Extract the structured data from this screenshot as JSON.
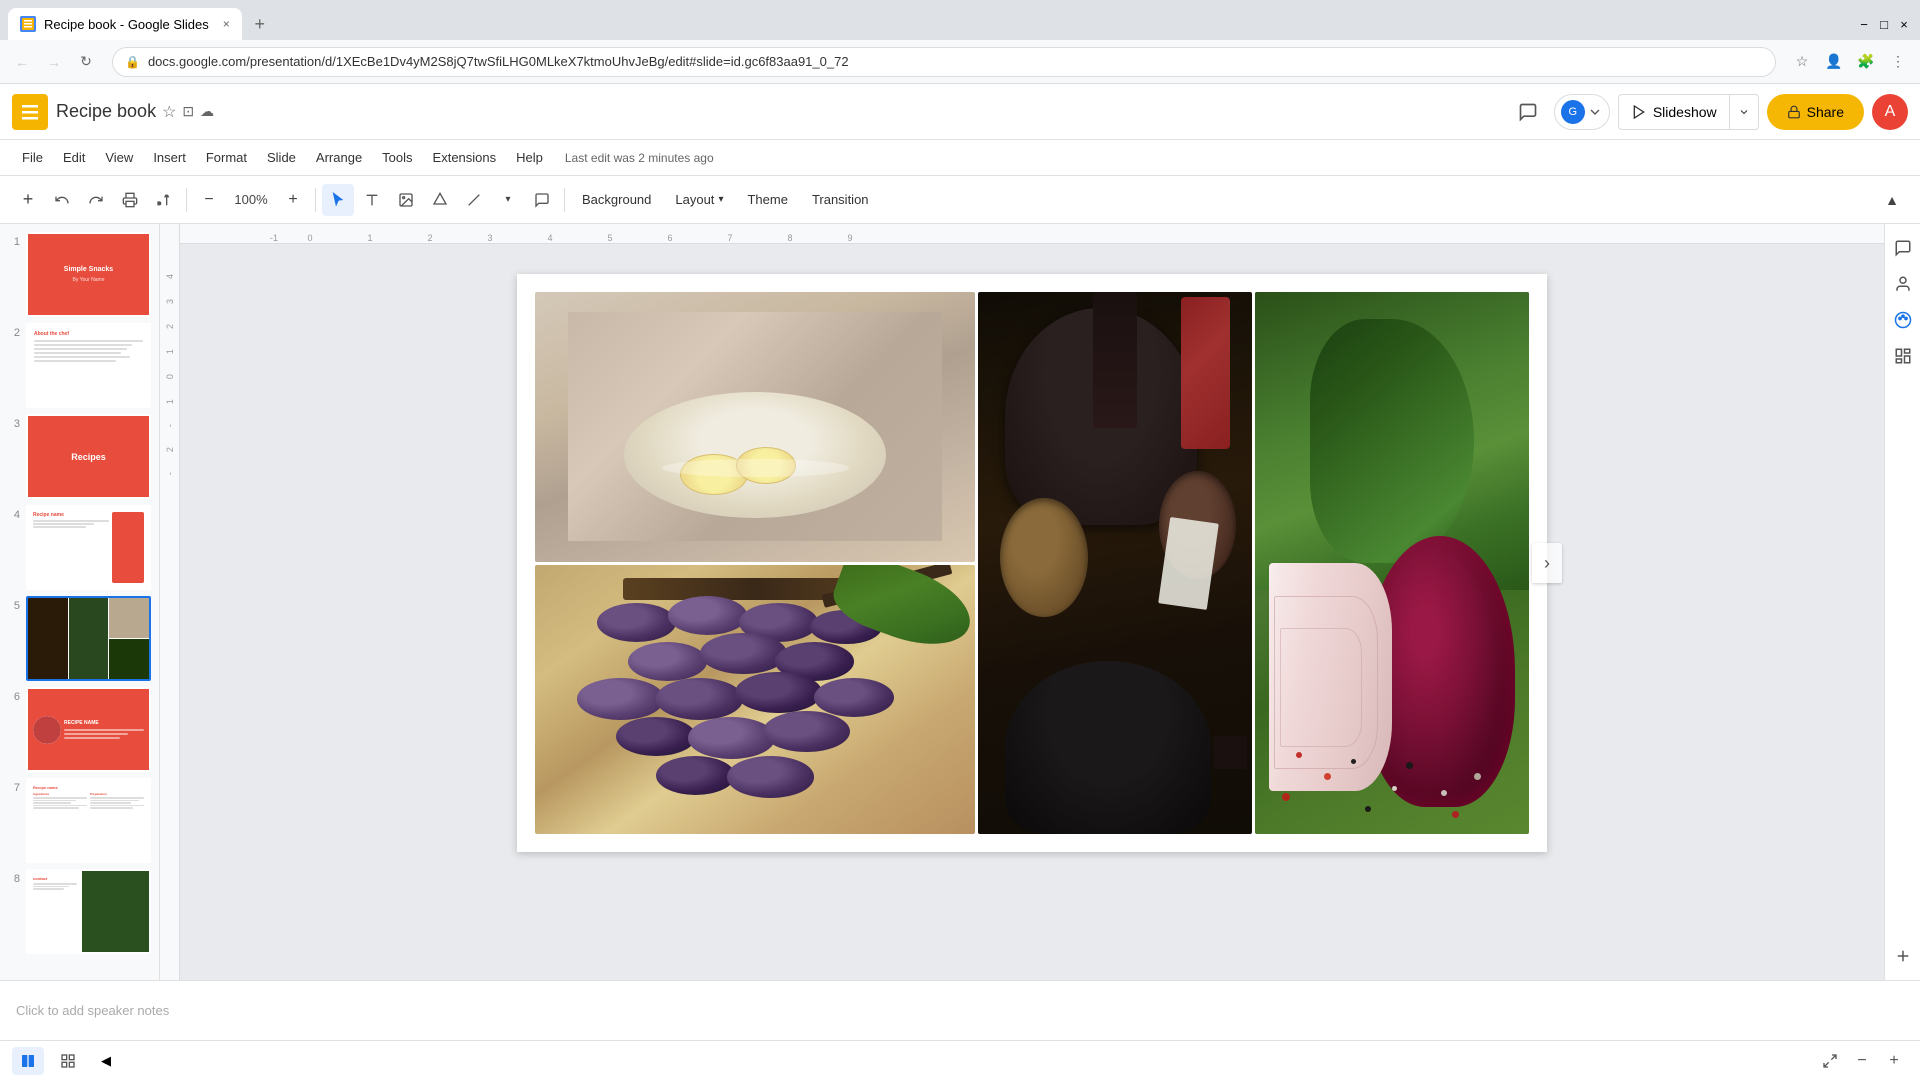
{
  "browser": {
    "tab_title": "Recipe book - Google Slides",
    "favicon_color": "#f4b400",
    "url": "docs.google.com/presentation/d/1XEcBe1Dv4yM2S8jQ7twSfiLHG0MLkeX7ktmoUhvJeBg/edit#slide=id.gc6f83aa91_0_72",
    "new_tab_label": "+",
    "tab_close": "×"
  },
  "header": {
    "app_logo_letter": "S",
    "doc_title": "Recipe book",
    "star_icon": "☆",
    "folder_icon": "📁",
    "cloud_icon": "☁",
    "comment_icon": "💬",
    "slideshow_label": "Slideshow",
    "slideshow_dropdown": "▾",
    "share_label": "Share",
    "share_icon": "🔒",
    "user_initial": "A"
  },
  "menu": {
    "items": [
      "File",
      "Edit",
      "View",
      "Insert",
      "Format",
      "Slide",
      "Arrange",
      "Tools",
      "Extensions",
      "Help"
    ],
    "last_edit": "Last edit was 2 minutes ago"
  },
  "toolbar": {
    "add_icon": "+",
    "undo_icon": "↩",
    "redo_icon": "↪",
    "print_icon": "🖨",
    "paint_icon": "🖌",
    "zoom_out": "−",
    "zoom_value": "100%",
    "zoom_in": "+",
    "select_icon": "↖",
    "text_icon": "T",
    "image_icon": "🖼",
    "shape_icon": "⬡",
    "line_icon": "/",
    "background_label": "Background",
    "layout_label": "Layout",
    "layout_arrow": "▾",
    "theme_label": "Theme",
    "transition_label": "Transition",
    "collapse_icon": "▲"
  },
  "slides": [
    {
      "num": "1",
      "type": "cover"
    },
    {
      "num": "2",
      "type": "about"
    },
    {
      "num": "3",
      "type": "section"
    },
    {
      "num": "4",
      "type": "recipe"
    },
    {
      "num": "5",
      "type": "photos",
      "active": true
    },
    {
      "num": "6",
      "type": "recipe-name"
    },
    {
      "num": "7",
      "type": "ingredients"
    },
    {
      "num": "8",
      "type": "greens"
    }
  ],
  "slide_content": {
    "title": "Simple Snacks",
    "subtitle": "By Your Name"
  },
  "bottom": {
    "notes_placeholder": "Click to add speaker notes",
    "slide_view_icon": "⊞",
    "grid_view_icon": "⊟",
    "collapse_panel": "◀",
    "zoom_in_icon": "+",
    "zoom_out_icon": "−"
  },
  "right_sidebar": {
    "comment_icon": "💬",
    "person_icon": "👤",
    "palette_icon": "🎨",
    "layout_icon": "▤",
    "plus_icon": "+"
  }
}
